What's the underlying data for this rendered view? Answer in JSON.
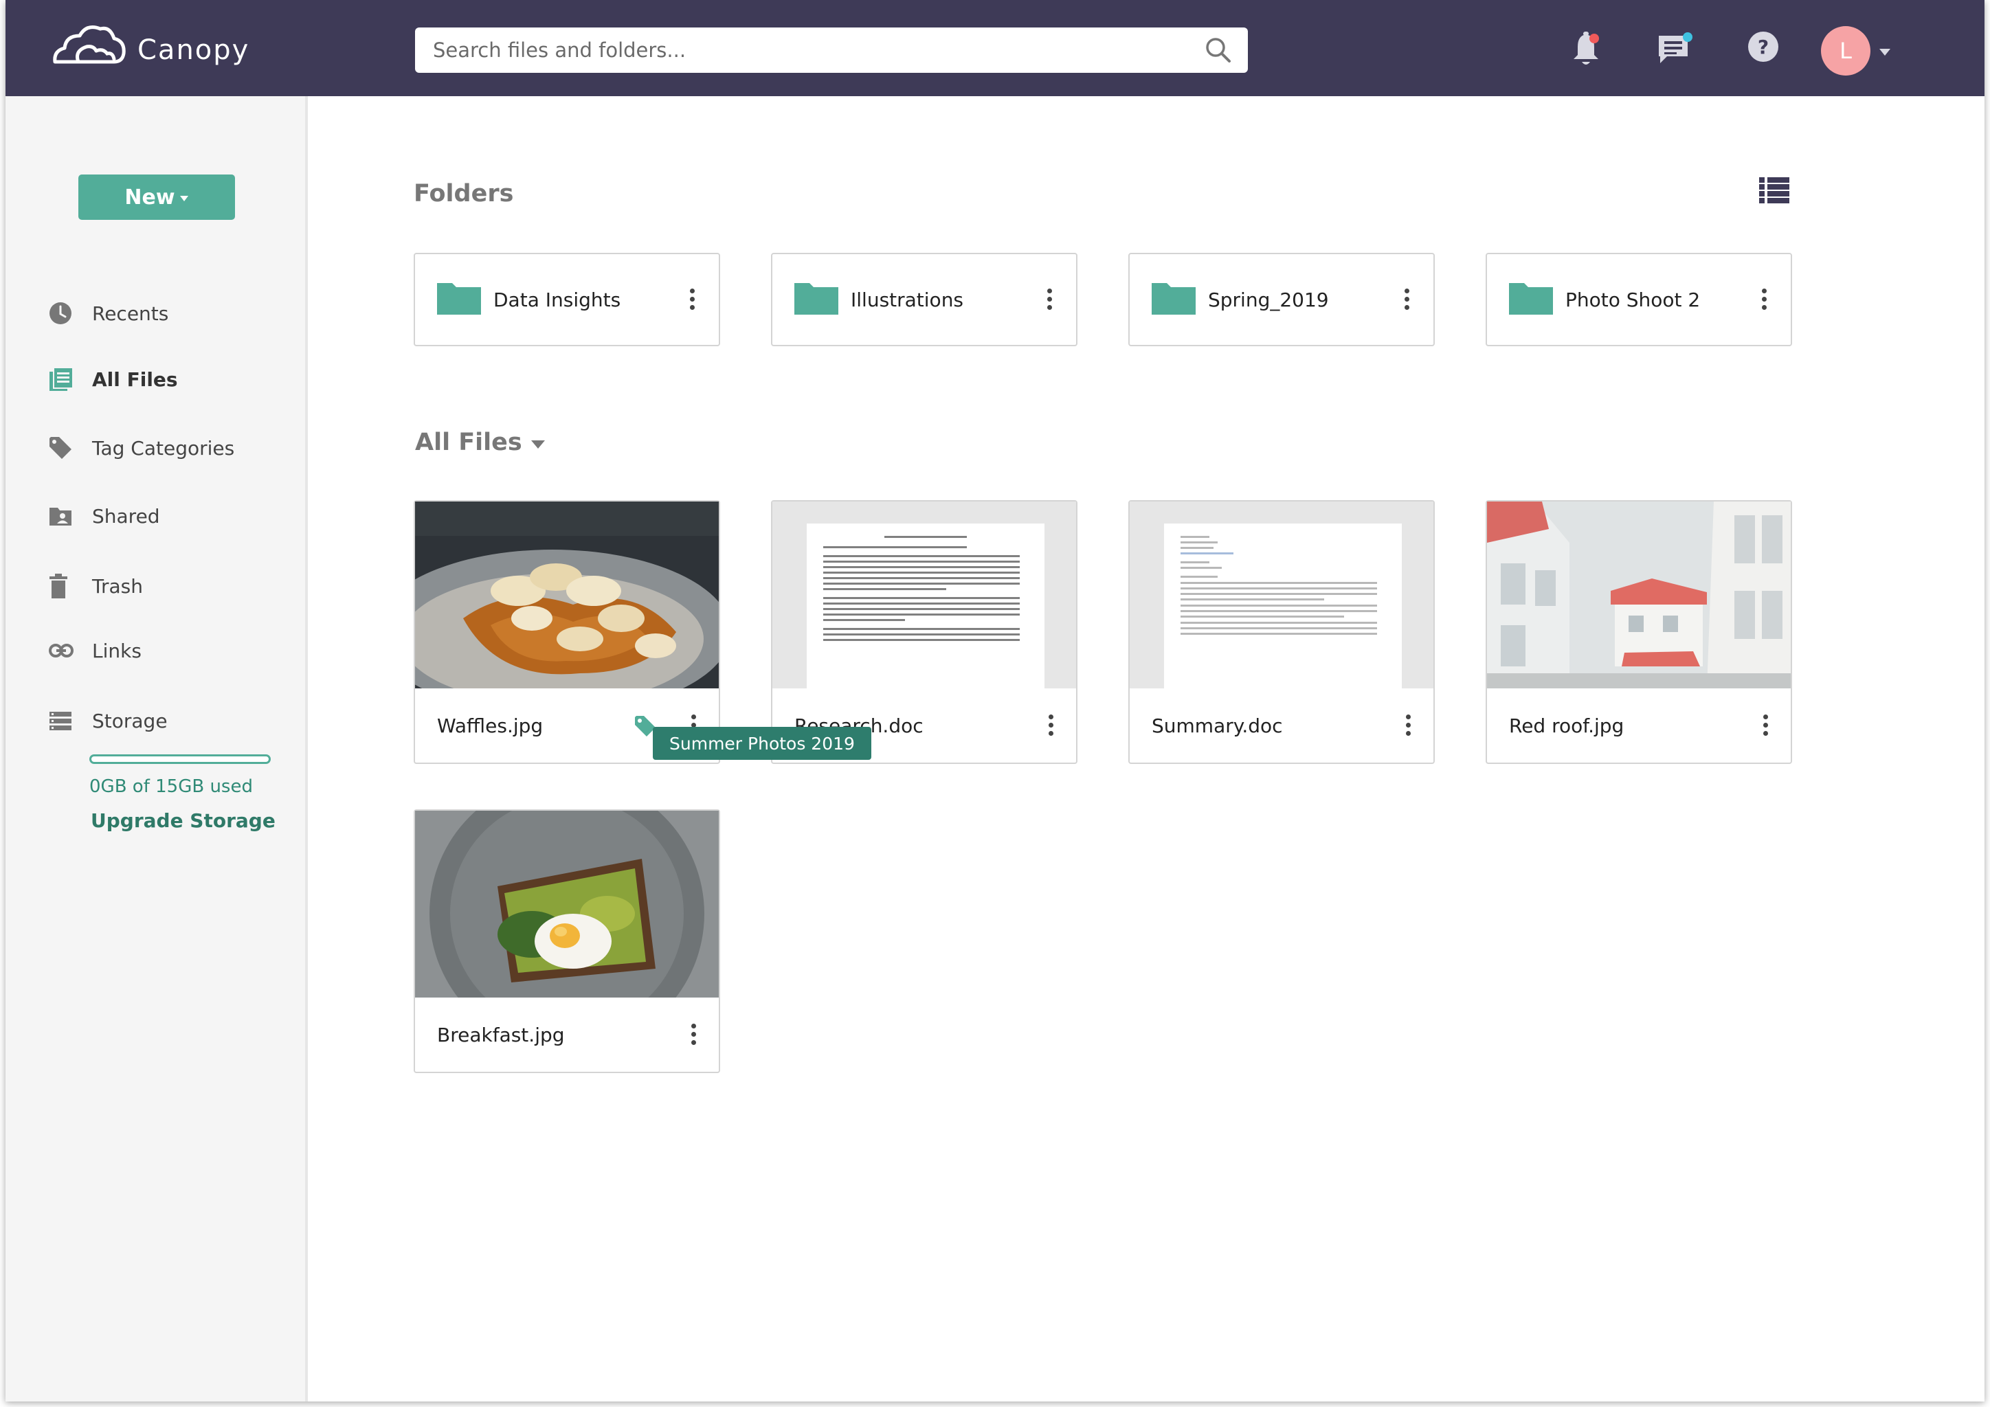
{
  "app": {
    "name": "Canopy"
  },
  "search": {
    "placeholder": "Search files and folders..."
  },
  "user": {
    "avatar_initial": "L"
  },
  "sidebar": {
    "new_button": "New",
    "items": [
      {
        "label": "Recents",
        "icon": "clock-icon"
      },
      {
        "label": "All Files",
        "icon": "files-icon",
        "active": true
      },
      {
        "label": "Tag Categories",
        "icon": "tag-icon"
      },
      {
        "label": "Shared",
        "icon": "shared-folder-icon"
      },
      {
        "label": "Trash",
        "icon": "trash-icon"
      },
      {
        "label": "Links",
        "icon": "link-icon"
      },
      {
        "label": "Storage",
        "icon": "storage-icon"
      }
    ],
    "storage": {
      "used_text": "0GB of 15GB used",
      "used_fraction": 0,
      "upgrade_label": "Upgrade Storage"
    }
  },
  "main": {
    "folders_title": "Folders",
    "folders": [
      {
        "name": "Data Insights"
      },
      {
        "name": "Illustrations"
      },
      {
        "name": "Spring_2019"
      },
      {
        "name": "Photo Shoot 2"
      }
    ],
    "files_title": "All Files",
    "files": [
      {
        "name": "Waffles.jpg",
        "thumbnail": "waffles-photo",
        "tag": "Summer Photos 2019"
      },
      {
        "name": "Research.doc",
        "thumbnail": "document-preview"
      },
      {
        "name": "Summary.doc",
        "thumbnail": "document-preview"
      },
      {
        "name": "Red roof.jpg",
        "thumbnail": "houses-photo"
      },
      {
        "name": "Breakfast.jpg",
        "thumbnail": "avocado-toast-photo"
      }
    ],
    "tooltip": "Summer Photos 2019"
  },
  "colors": {
    "header_bg": "#3e3a57",
    "accent": "#52ad99",
    "sidebar_bg": "#f5f5f5",
    "notification_dot": "#f05a5a",
    "message_dot": "#3fc1e0"
  }
}
